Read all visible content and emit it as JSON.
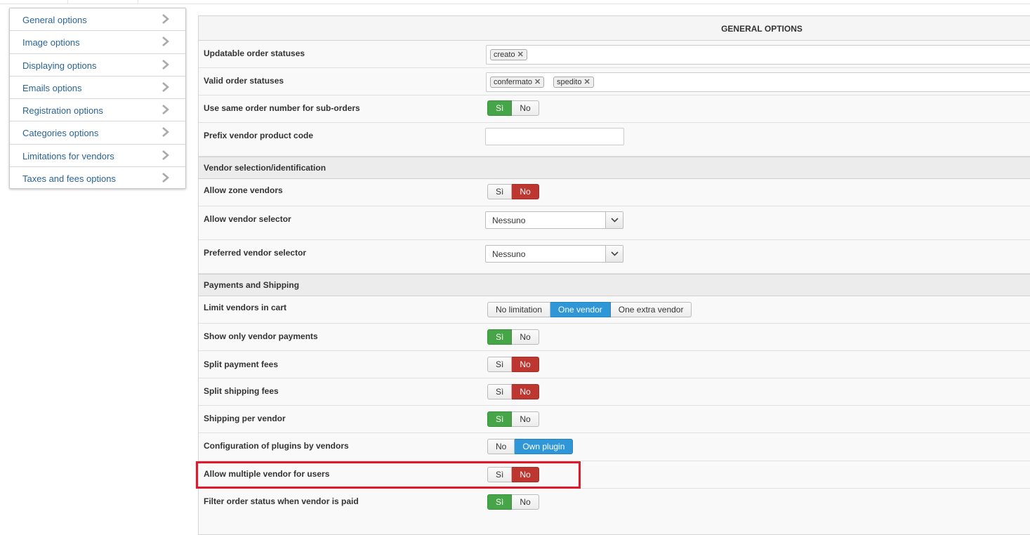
{
  "sidebar": {
    "items": [
      {
        "label": "General options"
      },
      {
        "label": "Image options"
      },
      {
        "label": "Displaying options"
      },
      {
        "label": "Emails options"
      },
      {
        "label": "Registration options"
      },
      {
        "label": "Categories options"
      },
      {
        "label": "Limitations for vendors"
      },
      {
        "label": "Taxes and fees options"
      }
    ]
  },
  "main": {
    "title": "GENERAL OPTIONS",
    "updatable_statuses": {
      "label": "Updatable order statuses",
      "chips": [
        "creato"
      ]
    },
    "valid_statuses": {
      "label": "Valid order statuses",
      "chips": [
        "confermato",
        "spedito"
      ]
    },
    "same_order_number": {
      "label": "Use same order number for sub-orders",
      "yes": "Sì",
      "no": "No",
      "selected": "yes"
    },
    "prefix_code": {
      "label": "Prefix vendor product code",
      "value": ""
    },
    "section_vendor": "Vendor selection/identification",
    "allow_zone_vendors": {
      "label": "Allow zone vendors",
      "yes": "Sì",
      "no": "No",
      "selected": "no"
    },
    "allow_vendor_selector": {
      "label": "Allow vendor selector",
      "value": "Nessuno"
    },
    "preferred_vendor_selector": {
      "label": "Preferred vendor selector",
      "value": "Nessuno"
    },
    "section_payments": "Payments and Shipping",
    "limit_vendors": {
      "label": "Limit vendors in cart",
      "options": [
        "No limitation",
        "One vendor",
        "One extra vendor"
      ],
      "selected": "One vendor"
    },
    "show_vendor_payments": {
      "label": "Show only vendor payments",
      "yes": "Sì",
      "no": "No",
      "selected": "yes"
    },
    "split_payment_fees": {
      "label": "Split payment fees",
      "yes": "Sì",
      "no": "No",
      "selected": "no"
    },
    "split_shipping_fees": {
      "label": "Split shipping fees",
      "yes": "Sì",
      "no": "No",
      "selected": "no"
    },
    "shipping_per_vendor": {
      "label": "Shipping per vendor",
      "yes": "Sì",
      "no": "No",
      "selected": "yes"
    },
    "plugins_config": {
      "label": "Configuration of plugins by vendors",
      "no": "No",
      "own": "Own plugin",
      "selected": "own"
    },
    "multiple_vendor": {
      "label": "Allow multiple vendor for users",
      "yes": "Sì",
      "no": "No",
      "selected": "no"
    },
    "filter_order_status": {
      "label": "Filter order status when vendor is paid",
      "yes": "Sì",
      "no": "No",
      "selected": "yes"
    }
  },
  "colors": {
    "green": "#46a546",
    "red": "#bd362f",
    "blue": "#2f96d8",
    "link": "#2a6496",
    "highlight": "#e3192b"
  }
}
